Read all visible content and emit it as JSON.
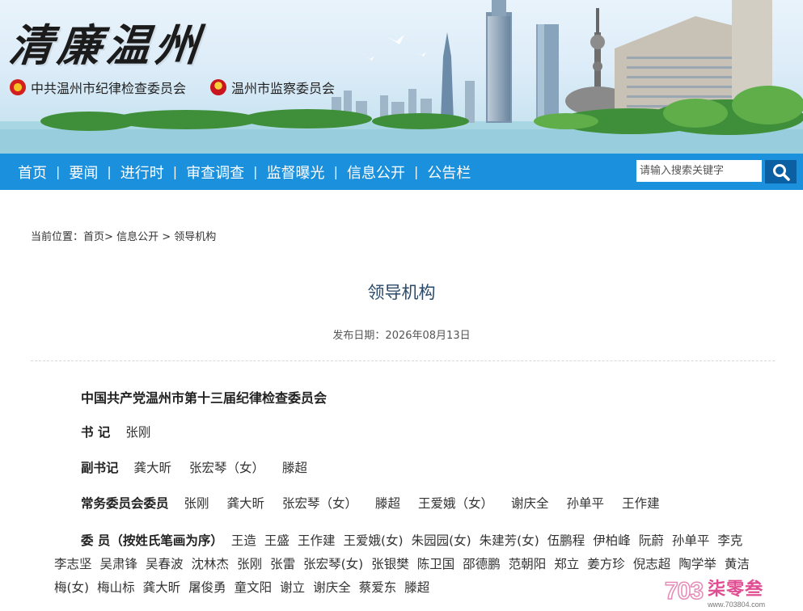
{
  "header": {
    "site_title": "清廉温州",
    "org1": "中共温州市纪律检查委员会",
    "org2": "温州市监察委员会"
  },
  "nav": {
    "items": [
      {
        "label": "首页"
      },
      {
        "label": "要闻"
      },
      {
        "label": "进行时"
      },
      {
        "label": "审查调查"
      },
      {
        "label": "监督曝光"
      },
      {
        "label": "信息公开"
      },
      {
        "label": "公告栏"
      }
    ],
    "separator": "|",
    "search_placeholder": "请输入搜索关键字",
    "search_icon": "search-icon"
  },
  "breadcrumb": {
    "prefix": "当前位置：",
    "home": "首页",
    "sep1": ">",
    "section": "信息公开",
    "sep2": ">",
    "current": "领导机构"
  },
  "article": {
    "title": "领导机构",
    "date_label": "发布日期：",
    "date": "2026年08月13日",
    "heading": "中国共产党温州市第十三届纪律检查委员会",
    "secretary": {
      "label": "书  记",
      "names": [
        "张刚"
      ]
    },
    "deputy": {
      "label": "副书记",
      "names": [
        "龚大昕",
        "张宏琴（女）",
        "滕超"
      ]
    },
    "standing": {
      "label": "常务委员会委员",
      "names": [
        "张刚",
        "龚大昕",
        "张宏琴（女）",
        "滕超",
        "王爱娥（女）",
        "谢庆全",
        "孙单平",
        "王作建"
      ]
    },
    "members": {
      "label": "委  员（按姓氏笔画为序）",
      "names": [
        "王造",
        "王盛",
        "王作建",
        "王爱娥(女)",
        "朱园园(女)",
        "朱建芳(女)",
        "伍鹏程",
        "伊柏峰",
        "阮蔚",
        "孙单平",
        "李克",
        "李志坚",
        "吴肃锋",
        "吴春波",
        "沈林杰",
        "张刚",
        "张雷",
        "张宏琴(女)",
        "张银樊",
        "陈卫国",
        "邵德鹏",
        "范朝阳",
        "郑立",
        "姜方珍",
        "倪志超",
        "陶学举",
        "黄洁梅(女)",
        "梅山标",
        "龚大昕",
        "屠俊勇",
        "童文阳",
        "谢立",
        "谢庆全",
        "蔡爱东",
        "滕超"
      ]
    }
  },
  "watermark": {
    "num": "703",
    "name": "柒零叁",
    "url": "www.703804.com"
  },
  "colors": {
    "nav_bg": "#1b90dc",
    "search_btn": "#0b5fa3",
    "title": "#2a4a6b"
  }
}
